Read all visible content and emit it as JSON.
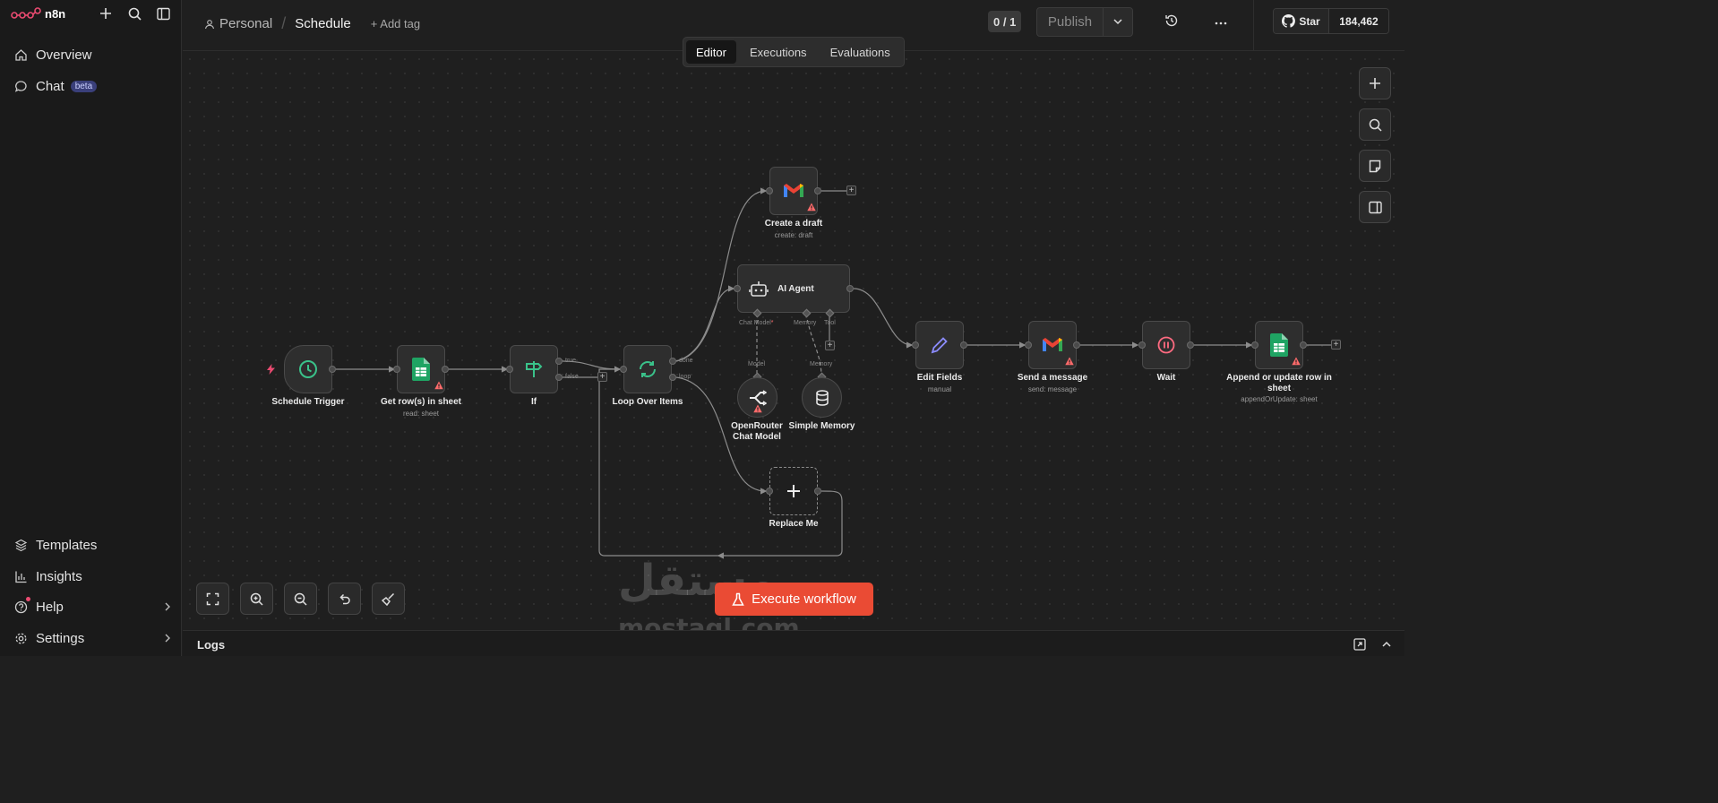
{
  "app": {
    "name": "n8n"
  },
  "sidebar": {
    "top": [
      {
        "label": "Overview",
        "icon": "home-icon"
      },
      {
        "label": "Chat",
        "icon": "chat-icon",
        "badge": "beta"
      }
    ],
    "bottom": [
      {
        "label": "Templates",
        "icon": "templates-icon"
      },
      {
        "label": "Insights",
        "icon": "insights-icon"
      },
      {
        "label": "Help",
        "icon": "help-icon"
      },
      {
        "label": "Settings",
        "icon": "settings-icon"
      }
    ]
  },
  "header": {
    "project": "Personal",
    "workflow": "Schedule",
    "add_tag": "+ Add tag",
    "counter": "0 / 1",
    "publish": "Publish",
    "github": {
      "star": "Star",
      "count": "184,462"
    }
  },
  "tabs": [
    {
      "label": "Editor",
      "active": true
    },
    {
      "label": "Executions",
      "active": false
    },
    {
      "label": "Evaluations",
      "active": false
    }
  ],
  "nodes": {
    "schedule_trigger": {
      "label": "Schedule Trigger"
    },
    "get_rows": {
      "label": "Get row(s) in sheet",
      "sub": "read: sheet"
    },
    "if": {
      "label": "If",
      "out_true": "true",
      "out_false": "false"
    },
    "loop": {
      "label": "Loop Over Items",
      "out_done": "done",
      "out_loop": "loop"
    },
    "create_draft": {
      "label": "Create a draft",
      "sub": "create: draft"
    },
    "ai_agent": {
      "label": "AI Agent",
      "in_model": "Chat Model",
      "in_memory": "Memory",
      "in_tool": "Tool"
    },
    "openrouter": {
      "label": "OpenRouter Chat Model",
      "port": "Model"
    },
    "memory": {
      "label": "Simple Memory",
      "port": "Memory"
    },
    "replace_me": {
      "label": "Replace Me"
    },
    "edit_fields": {
      "label": "Edit Fields",
      "sub": "manual"
    },
    "send_message": {
      "label": "Send a message",
      "sub": "send: message"
    },
    "wait": {
      "label": "Wait"
    },
    "append_row": {
      "label": "Append or update row in sheet",
      "sub": "appendOrUpdate: sheet"
    }
  },
  "execute_button": "Execute workflow",
  "logs": {
    "title": "Logs"
  },
  "watermark": {
    "arabic": "مستقل",
    "latin": "mostaql.com"
  },
  "colors": {
    "accent": "#ea4b34",
    "node_bg": "#2e2e2e",
    "warning": "#ff6b6b",
    "sheets_green": "#1fa463"
  }
}
